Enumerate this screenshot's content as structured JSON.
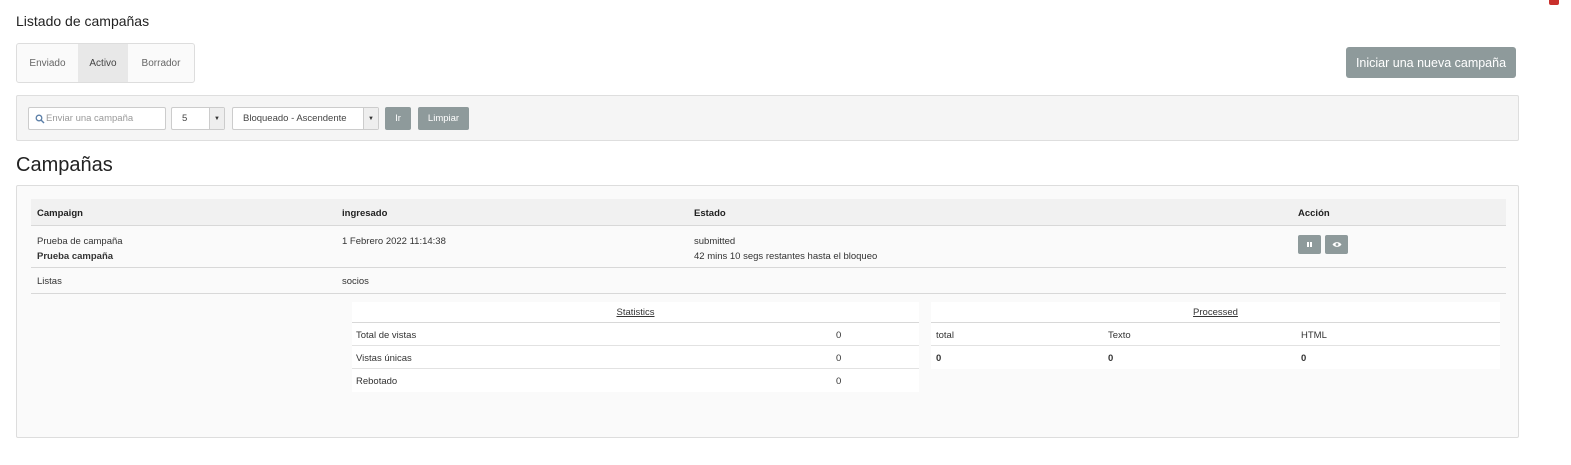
{
  "page": {
    "title": "Listado de campañas"
  },
  "tabs": [
    {
      "label": "Enviado"
    },
    {
      "label": "Activo",
      "active": true
    },
    {
      "label": "Borrador"
    }
  ],
  "new_campaign_button": "Iniciar una nueva campaña",
  "filters": {
    "search_placeholder": "Enviar una campaña",
    "count_value": "5",
    "sort_value": "Bloqueado - Ascendente",
    "go_label": "Ir",
    "clear_label": "Limpiar"
  },
  "section_title": "Campañas",
  "table": {
    "headers": [
      "Campaign",
      "ingresado",
      "Estado",
      "Acción"
    ],
    "row": {
      "campaign_label": "Prueba de campaña",
      "campaign_name": "Prueba campaña",
      "entered": "1 Febrero 2022 11:14:38",
      "status": "submitted",
      "status_detail": "42 mins 10 segs restantes hasta el bloqueo"
    },
    "lists_label": "Listas",
    "lists_value": "socios"
  },
  "statistics": {
    "title": "Statistics",
    "rows": [
      {
        "label": "Total de vistas",
        "value": "0"
      },
      {
        "label": "Vistas únicas",
        "value": "0"
      },
      {
        "label": "Rebotado",
        "value": "0"
      }
    ]
  },
  "processed": {
    "title": "Processed",
    "headers": [
      "total",
      "Texto",
      "HTML"
    ],
    "values": [
      "0",
      "0",
      "0"
    ]
  },
  "colors": {
    "button_gray": "#8e9a9b",
    "badge_red": "#c9302c"
  },
  "icons": [
    "search-icon",
    "caret-down-icon",
    "pause-icon",
    "eye-icon"
  ]
}
